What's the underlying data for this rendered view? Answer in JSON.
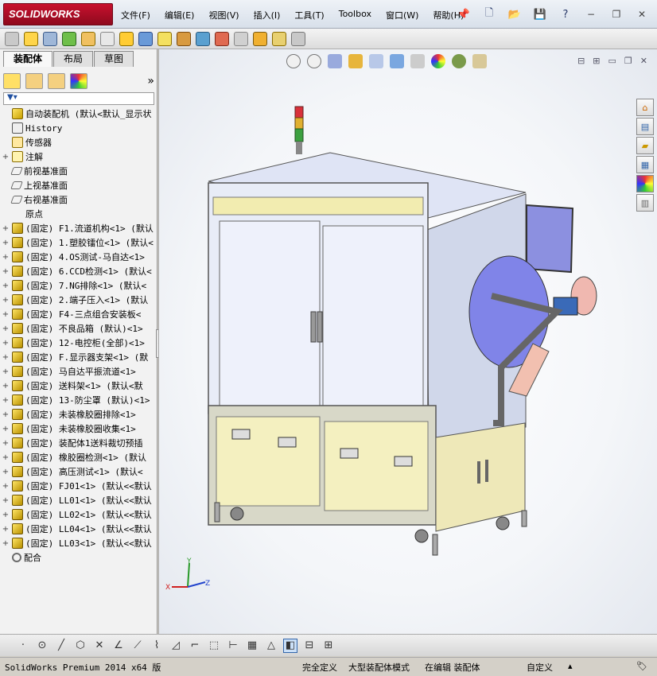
{
  "app": {
    "logo_text": "SOLIDWORKS",
    "menu": [
      "文件(F)",
      "编辑(E)",
      "视图(V)",
      "插入(I)",
      "工具(T)",
      "Toolbox",
      "窗口(W)",
      "帮助(H)"
    ]
  },
  "left_panel": {
    "tabs": [
      "装配体",
      "布局",
      "草图"
    ],
    "active_tab": "装配体",
    "tree": [
      {
        "label": "自动装配机   (默认<默认_显示状",
        "icon": "ic-asm",
        "expander": ""
      },
      {
        "label": "History",
        "icon": "ic-hist",
        "expander": ""
      },
      {
        "label": "传感器",
        "icon": "ic-sens",
        "expander": ""
      },
      {
        "label": "注解",
        "icon": "ic-annot",
        "expander": "+"
      },
      {
        "label": "前视基准面",
        "icon": "ic-plane",
        "expander": ""
      },
      {
        "label": "上视基准面",
        "icon": "ic-plane",
        "expander": ""
      },
      {
        "label": "右视基准面",
        "icon": "ic-plane",
        "expander": ""
      },
      {
        "label": "原点",
        "icon": "ic-origin",
        "expander": ""
      },
      {
        "label": "(固定) F1.流道机构<1> (默认",
        "icon": "ic-part",
        "expander": "+"
      },
      {
        "label": "(固定) 1.塑胶镭位<1> (默认<",
        "icon": "ic-part",
        "expander": "+"
      },
      {
        "label": "(固定) 4.OS测试-马自达<1>",
        "icon": "ic-part",
        "expander": "+"
      },
      {
        "label": "(固定) 6.CCD检测<1> (默认<",
        "icon": "ic-part",
        "expander": "+"
      },
      {
        "label": "(固定) 7.NG排除<1> (默认<",
        "icon": "ic-part",
        "expander": "+"
      },
      {
        "label": "(固定) 2.端子压入<1> (默认",
        "icon": "ic-part",
        "expander": "+"
      },
      {
        "label": "(固定) F4-三点组合安装板<",
        "icon": "ic-part",
        "expander": "+"
      },
      {
        "label": "(固定) 不良品箱 (默认)<1>",
        "icon": "ic-part",
        "expander": "+"
      },
      {
        "label": "(固定) 12-电控柜(全部)<1>",
        "icon": "ic-part",
        "expander": "+"
      },
      {
        "label": "(固定) F.显示器支架<1> (默",
        "icon": "ic-part",
        "expander": "+"
      },
      {
        "label": "(固定) 马自达平振流道<1>",
        "icon": "ic-part",
        "expander": "+"
      },
      {
        "label": "(固定) 送料架<1> (默认<默",
        "icon": "ic-part",
        "expander": "+"
      },
      {
        "label": "(固定) 13-防尘罩 (默认)<1>",
        "icon": "ic-part",
        "expander": "+"
      },
      {
        "label": "(固定) 未装橡胶圈排除<1>",
        "icon": "ic-part",
        "expander": "+"
      },
      {
        "label": "(固定) 未装橡胶圈收集<1>",
        "icon": "ic-part",
        "expander": "+"
      },
      {
        "label": "(固定) 装配体1送料裁切预插",
        "icon": "ic-part",
        "expander": "+"
      },
      {
        "label": "(固定) 橡胶圈检测<1> (默认",
        "icon": "ic-part",
        "expander": "+"
      },
      {
        "label": "(固定) 高压测试<1> (默认<",
        "icon": "ic-part",
        "expander": "+"
      },
      {
        "label": "(固定) FJ01<1> (默认<<默认",
        "icon": "ic-part",
        "expander": "+"
      },
      {
        "label": "(固定) LL01<1> (默认<<默认",
        "icon": "ic-part",
        "expander": "+"
      },
      {
        "label": "(固定) LL02<1> (默认<<默认",
        "icon": "ic-part",
        "expander": "+"
      },
      {
        "label": "(固定) LL04<1> (默认<<默认",
        "icon": "ic-part",
        "expander": "+"
      },
      {
        "label": "(固定) LL03<1> (默认<<默认",
        "icon": "ic-part",
        "expander": "+"
      },
      {
        "label": "配合",
        "icon": "ic-mate",
        "expander": ""
      }
    ]
  },
  "graphics": {
    "triad": {
      "x": "X",
      "y": "Y",
      "z": "Z"
    }
  },
  "status": {
    "product": "SolidWorks Premium 2014 x64 版",
    "state1": "完全定义",
    "state2": "大型装配体模式",
    "state3": "在编辑 装配体",
    "custom": "自定义"
  }
}
